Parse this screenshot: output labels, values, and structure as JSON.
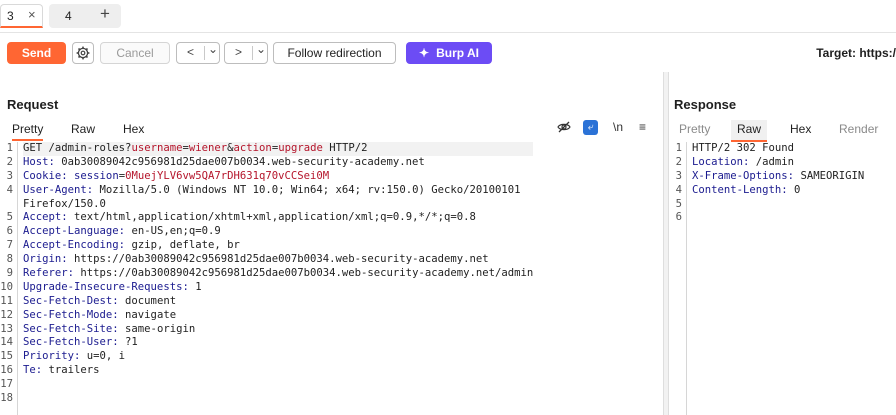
{
  "tabs": [
    {
      "label": "3",
      "active": true,
      "close": "×"
    },
    {
      "label": "4",
      "active": false
    }
  ],
  "add_tab": "+",
  "toolbar": {
    "send": "Send",
    "cancel": "Cancel",
    "back_arrow": "<",
    "back_menu": "⌄",
    "fwd_arrow": ">",
    "fwd_menu": "⌄",
    "follow": "Follow redirection",
    "ai": "Burp AI",
    "ai_icon": "✦",
    "target": "Target: https:/"
  },
  "request": {
    "title": "Request",
    "tabs": [
      "Pretty",
      "Raw",
      "Hex"
    ],
    "active_tab": "Pretty",
    "icons": {
      "hide": "eye-off-icon",
      "wrap": "word-wrap-icon",
      "newline": "\\n",
      "menu": "≡"
    },
    "lines": [
      {
        "n": "1",
        "parts": [
          [
            "GET /admin-roles?",
            "v"
          ],
          [
            "username",
            "p"
          ],
          [
            "=",
            "v"
          ],
          [
            "wiener",
            "p"
          ],
          [
            "&",
            "v"
          ],
          [
            "action",
            "p"
          ],
          [
            "=",
            "v"
          ],
          [
            "upgrade",
            "p"
          ],
          [
            " HTTP/2",
            "v"
          ]
        ]
      },
      {
        "n": "2",
        "parts": [
          [
            "Host:",
            "k"
          ],
          [
            " 0ab30089042c956981d25dae007b0034.web-security-academy.net",
            "v"
          ]
        ]
      },
      {
        "n": "3",
        "parts": [
          [
            "Cookie:",
            "k"
          ],
          [
            " ",
            "v"
          ],
          [
            "session",
            "k"
          ],
          [
            "=",
            "v"
          ],
          [
            "0MuejYLV6vw5QA7rDH631q70vCCSei0M",
            "p"
          ]
        ]
      },
      {
        "n": "4",
        "parts": [
          [
            "User-Agent:",
            "k"
          ],
          [
            " Mozilla/5.0 (Windows NT 10.0; Win64; x64; rv:150.0) Gecko/20100101",
            "v"
          ]
        ]
      },
      {
        "n": "",
        "parts": [
          [
            "Firefox/150.0",
            "v"
          ]
        ]
      },
      {
        "n": "5",
        "parts": [
          [
            "Accept:",
            "k"
          ],
          [
            " text/html,application/xhtml+xml,application/xml;q=0.9,*/*;q=0.8",
            "v"
          ]
        ]
      },
      {
        "n": "6",
        "parts": [
          [
            "Accept-Language:",
            "k"
          ],
          [
            " en-US,en;q=0.9",
            "v"
          ]
        ]
      },
      {
        "n": "7",
        "parts": [
          [
            "Accept-Encoding:",
            "k"
          ],
          [
            " gzip, deflate, br",
            "v"
          ]
        ]
      },
      {
        "n": "8",
        "parts": [
          [
            "Origin:",
            "k"
          ],
          [
            " https://0ab30089042c956981d25dae007b0034.web-security-academy.net",
            "v"
          ]
        ]
      },
      {
        "n": "9",
        "parts": [
          [
            "Referer:",
            "k"
          ],
          [
            " https://0ab30089042c956981d25dae007b0034.web-security-academy.net/admin",
            "v"
          ]
        ]
      },
      {
        "n": "10",
        "parts": [
          [
            "Upgrade-Insecure-Requests:",
            "k"
          ],
          [
            " 1",
            "v"
          ]
        ]
      },
      {
        "n": "11",
        "parts": [
          [
            "Sec-Fetch-Dest:",
            "k"
          ],
          [
            " document",
            "v"
          ]
        ]
      },
      {
        "n": "12",
        "parts": [
          [
            "Sec-Fetch-Mode:",
            "k"
          ],
          [
            " navigate",
            "v"
          ]
        ]
      },
      {
        "n": "13",
        "parts": [
          [
            "Sec-Fetch-Site:",
            "k"
          ],
          [
            " same-origin",
            "v"
          ]
        ]
      },
      {
        "n": "14",
        "parts": [
          [
            "Sec-Fetch-User:",
            "k"
          ],
          [
            " ?1",
            "v"
          ]
        ]
      },
      {
        "n": "15",
        "parts": [
          [
            "Priority:",
            "k"
          ],
          [
            " u=0, i",
            "v"
          ]
        ]
      },
      {
        "n": "16",
        "parts": [
          [
            "Te:",
            "k"
          ],
          [
            " trailers",
            "v"
          ]
        ]
      },
      {
        "n": "17",
        "parts": []
      },
      {
        "n": "18",
        "parts": []
      }
    ]
  },
  "response": {
    "title": "Response",
    "tabs": [
      "Pretty",
      "Raw",
      "Hex",
      "Render"
    ],
    "active_tab": "Raw",
    "lines": [
      {
        "n": "1",
        "parts": [
          [
            "HTTP/2 302 Found",
            "v"
          ]
        ]
      },
      {
        "n": "2",
        "parts": [
          [
            "Location:",
            "k"
          ],
          [
            " /admin",
            "v"
          ]
        ]
      },
      {
        "n": "3",
        "parts": [
          [
            "X-Frame-Options:",
            "k"
          ],
          [
            " SAMEORIGIN",
            "v"
          ]
        ]
      },
      {
        "n": "4",
        "parts": [
          [
            "Content-Length:",
            "k"
          ],
          [
            " 0",
            "v"
          ]
        ]
      },
      {
        "n": "5",
        "parts": []
      },
      {
        "n": "6",
        "parts": []
      }
    ]
  },
  "colors": {
    "accent": "#ff6633",
    "ai": "#6c4cf5",
    "header_key": "#1b1b8f",
    "param": "#b5152b"
  }
}
